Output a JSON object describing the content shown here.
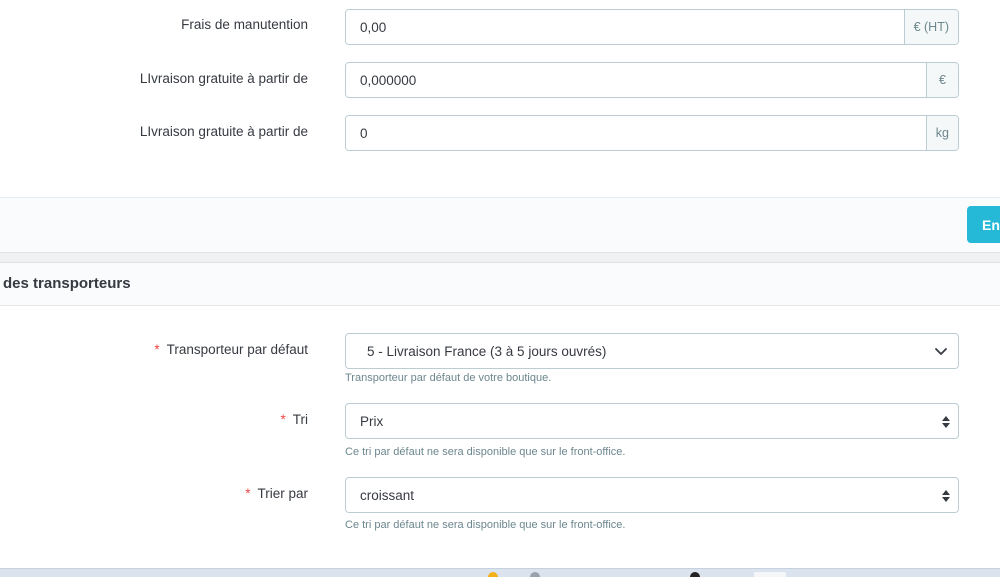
{
  "carrier_costs": {
    "handling_fees": {
      "label": "Frais de manutention",
      "value": "0,00",
      "unit": "€ (HT)"
    },
    "free_shipping_price": {
      "label": "LIvraison gratuite à partir de",
      "value": "0,000000",
      "unit": "€"
    },
    "free_shipping_weight": {
      "label": "LIvraison gratuite à partir de",
      "value": "0",
      "unit": "kg"
    },
    "save_label": "Enr"
  },
  "carrier_options": {
    "title": "des transporteurs",
    "default_carrier": {
      "required_mark": "*",
      "label": "Transporteur par défaut",
      "value": "5 - Livraison France (3 à 5 jours ouvrés)",
      "help": "Transporteur par défaut de votre boutique."
    },
    "sort": {
      "required_mark": "*",
      "label": "Tri",
      "value": "Prix",
      "help": "Ce tri par défaut ne sera disponible que sur le front-office."
    },
    "order": {
      "required_mark": "*",
      "label": "Trier par",
      "value": "croissant",
      "help": "Ce tri par défaut ne sera disponible que sur le front-office."
    }
  },
  "colors": {
    "primary": "#25b9d7",
    "required": "#e84545",
    "border": "#bbcdd2"
  }
}
